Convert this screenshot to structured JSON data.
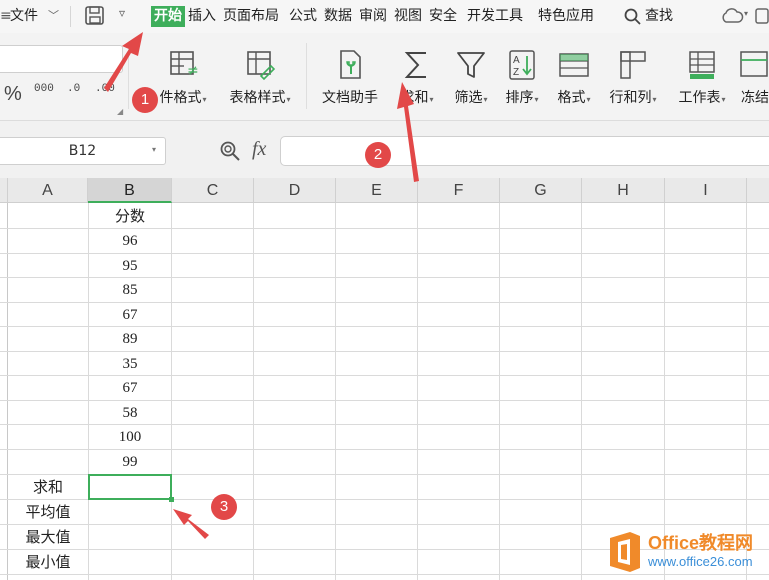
{
  "menu": {
    "items": [
      {
        "label": "文件"
      },
      {
        "label": "开始",
        "active": true
      },
      {
        "label": "插入"
      },
      {
        "label": "页面布局"
      },
      {
        "label": "公式"
      },
      {
        "label": "数据"
      },
      {
        "label": "审阅"
      },
      {
        "label": "视图"
      },
      {
        "label": "安全"
      },
      {
        "label": "开发工具"
      },
      {
        "label": "特色应用"
      },
      {
        "label": "查找"
      }
    ],
    "accent_color": "#3eae5b"
  },
  "ribbon": {
    "number_format_glyphs": [
      "%",
      "000",
      ".0",
      ".00"
    ],
    "buttons": [
      {
        "label": "件格式",
        "icon": "conditional-format-icon"
      },
      {
        "label": "表格样式",
        "icon": "table-style-icon"
      },
      {
        "label": "文档助手",
        "icon": "doc-helper-icon"
      },
      {
        "label": "求和",
        "icon": "sum-icon"
      },
      {
        "label": "筛选",
        "icon": "filter-icon"
      },
      {
        "label": "排序",
        "icon": "sort-icon"
      },
      {
        "label": "格式",
        "icon": "format-icon"
      },
      {
        "label": "行和列",
        "icon": "row-col-icon"
      },
      {
        "label": "工作表",
        "icon": "worksheet-icon"
      },
      {
        "label": "冻结",
        "icon": "freeze-icon"
      }
    ]
  },
  "formula_bar": {
    "name_box": "B12",
    "fx_label": "fx",
    "formula": ""
  },
  "sheet": {
    "columns": [
      "A",
      "B",
      "C",
      "D",
      "E",
      "F",
      "G",
      "H",
      "I"
    ],
    "selected_column": "B",
    "header_b": "分数",
    "scores": [
      "96",
      "95",
      "85",
      "67",
      "89",
      "35",
      "67",
      "58",
      "100",
      "99"
    ],
    "row_labels": [
      "求和",
      "平均值",
      "最大值",
      "最小值"
    ]
  },
  "annotations": [
    "1",
    "2",
    "3"
  ],
  "watermark": {
    "line1": "Office教程网",
    "line2": "www.office26.com"
  }
}
